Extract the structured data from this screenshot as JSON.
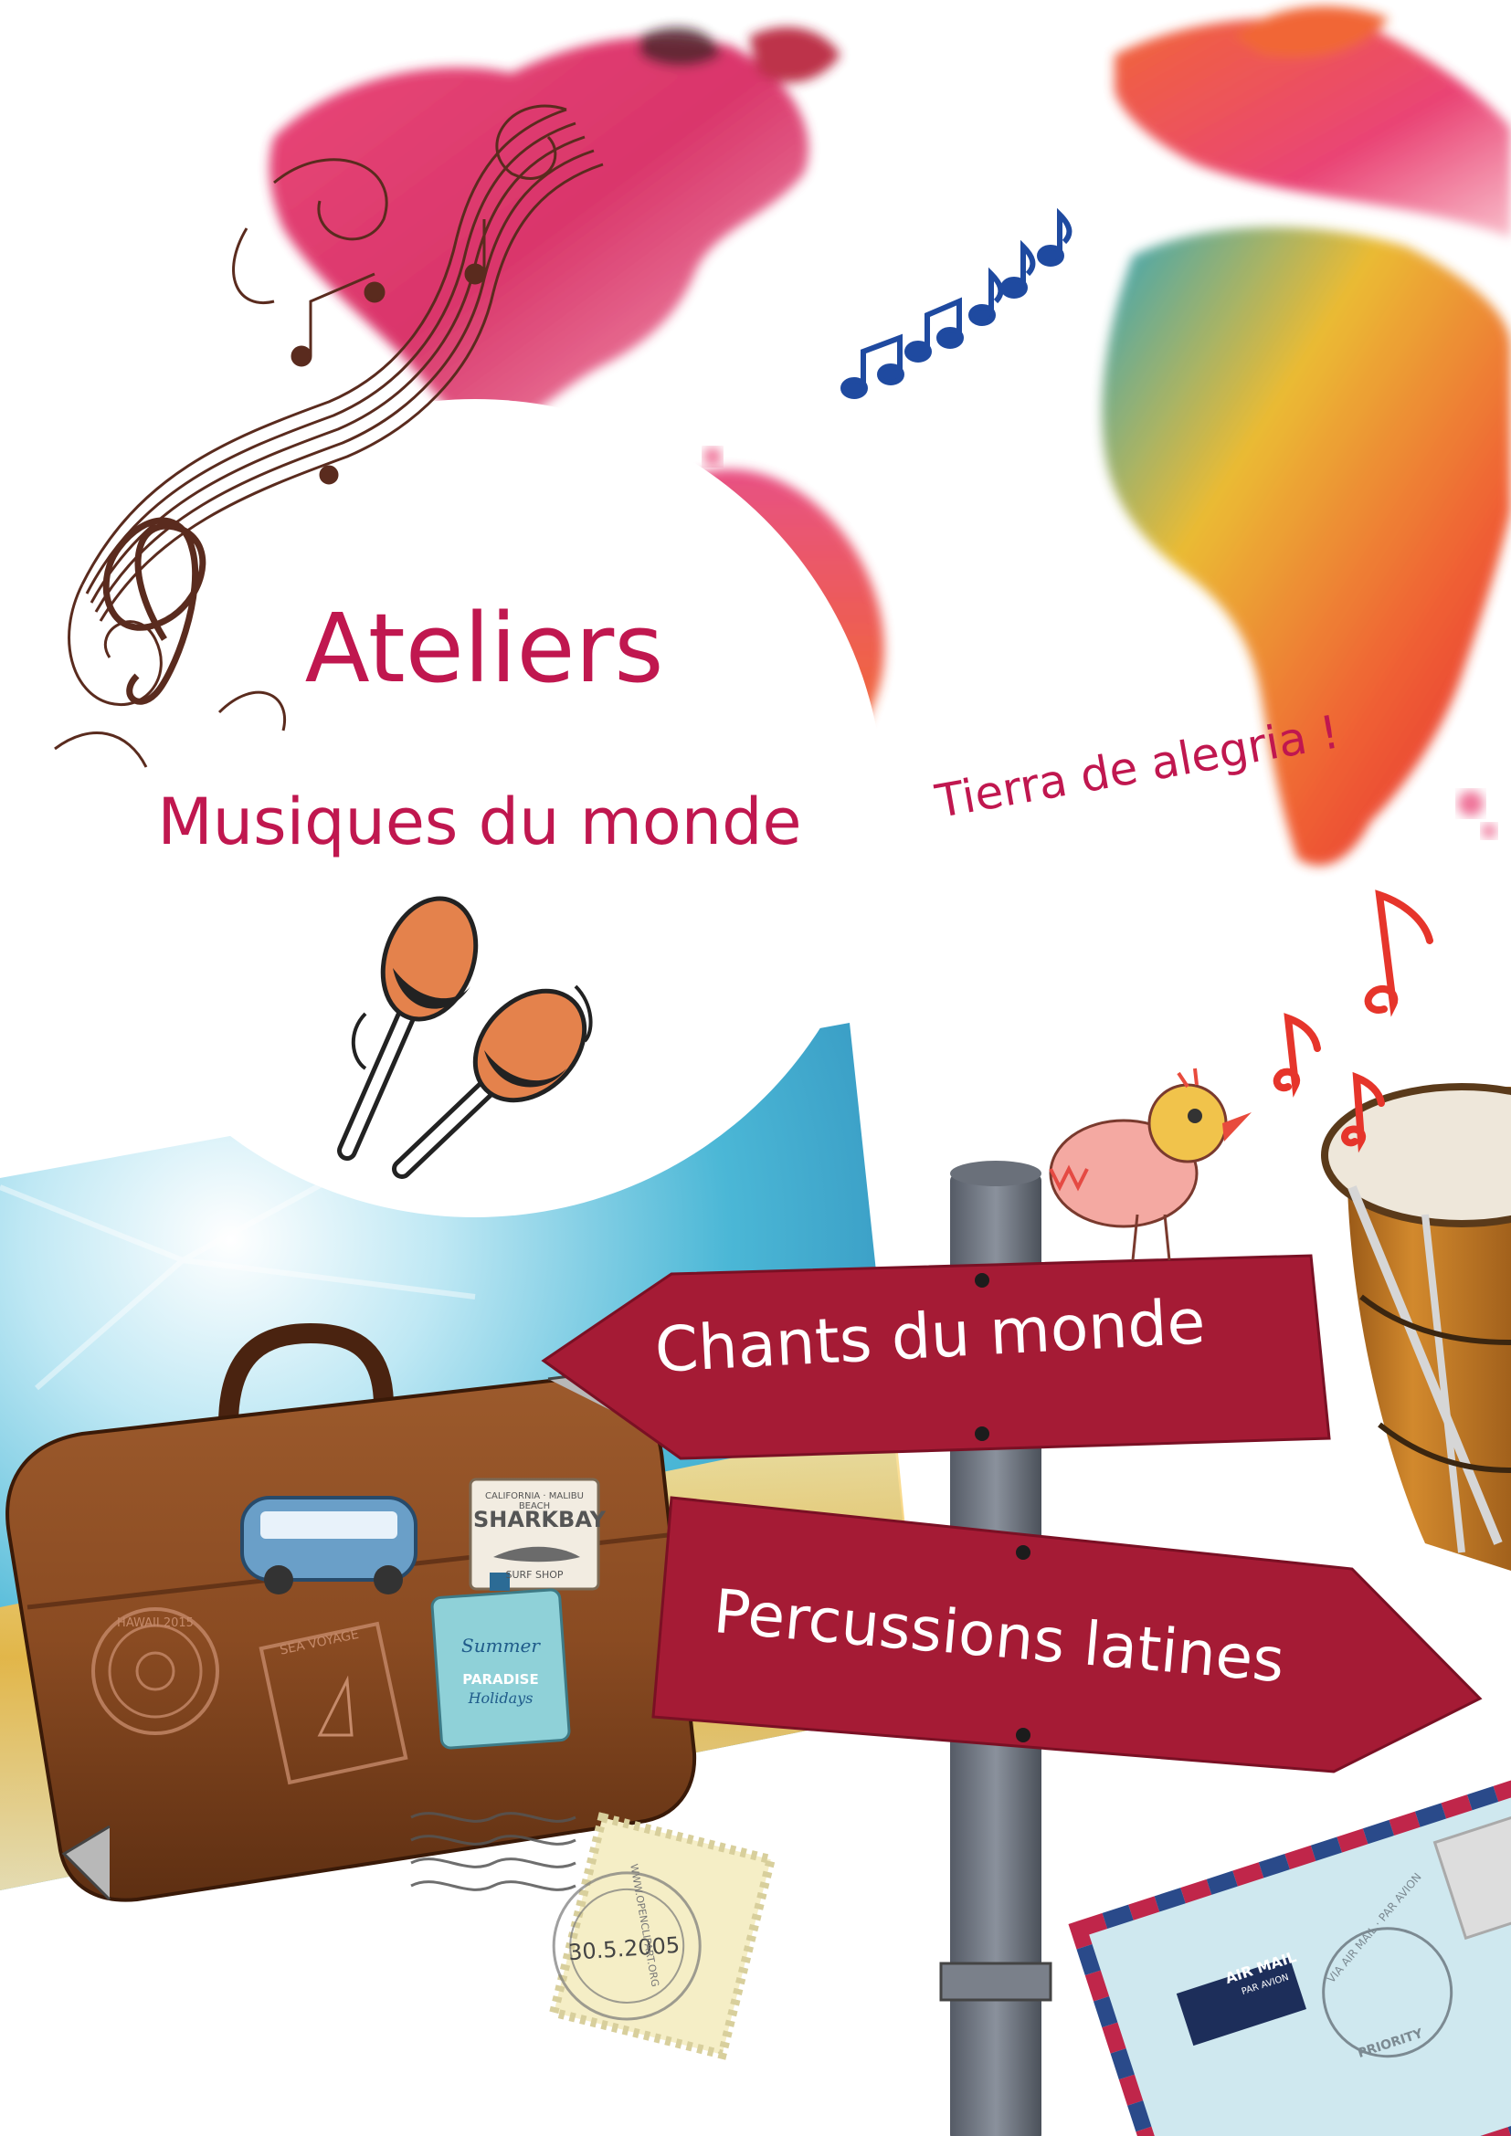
{
  "poster": {
    "title": "Ateliers",
    "subtitle": "Musiques du monde",
    "tagline": "Tierra de alegria !"
  },
  "signs": {
    "left": "Chants du monde",
    "right": "Percussions latines"
  },
  "stickers": {
    "sharkbay_top": "CALIFORNIA · MALIBU BEACH",
    "sharkbay": "SHARKBAY",
    "sharkbay_bottom": "SURF SHOP",
    "hawaii": "HAWAII 2015",
    "voyage": "SEA VOYAGE",
    "summer": "Summer",
    "paradise": "PARADISE",
    "holidays": "Holidays"
  },
  "stamp": {
    "date": "30.5.2005",
    "ring": "WWW.OPENCLIPART.ORG"
  },
  "airmail": {
    "label": "AIR MAIL",
    "sub": "PAR AVION",
    "ring": "VIA AIR MAIL · PAR AVION",
    "priority": "PRIORITY"
  },
  "colors": {
    "title": "#c0174f",
    "sign": "#a51b35",
    "notes_blue": "#1f4aa0",
    "notes_red": "#e6352b"
  }
}
